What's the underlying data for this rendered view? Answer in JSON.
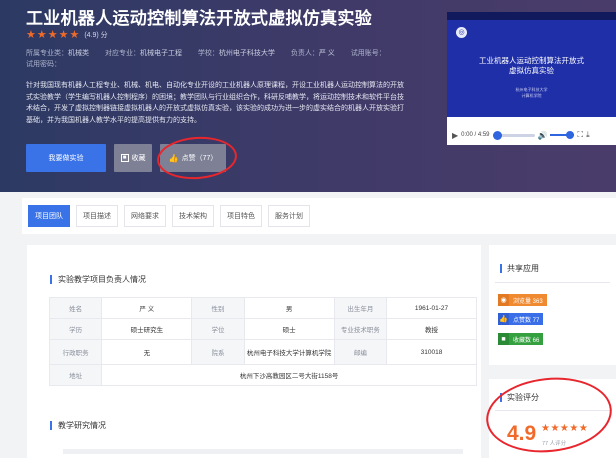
{
  "hero": {
    "title": "工业机器人运动控制算法开放式虚拟仿真实验",
    "stars": "★★★★★",
    "rating_text": "(4.9) 分",
    "meta": {
      "category_label": "所属专业类：",
      "category": "机械类",
      "major_label": "对应专业：",
      "major": "机械电子工程",
      "school_label": "学校：",
      "school": "杭州电子科技大学",
      "owner_label": "负责人：",
      "owner": "严 义",
      "account_label": "试用账号：",
      "account": "",
      "password_label": "试用密码：",
      "password": ""
    },
    "description": "针对我国现有机器人工程专业、机械、机电、自动化专业开设的工业机器人原理课程，开设工业机器人运动控制算法的开放式实验教学（学生编写机器人控制程序）的困境；教学团队与行业组织合作，科研反哺教学，将运动控制技术和软件平台技术结合，开发了虚拟控制器链接虚拟机器人的开放式虚拟仿真实验，该实验的成功为进一步的虚实结合的机器人开放实验打基础，并为我国机器人教学水平的提高提供有力的支持。",
    "buttons": {
      "start": "我要做实验",
      "favorite": "收藏",
      "like": "点赞（77）"
    }
  },
  "video": {
    "title_line1": "工业机器人运动控制算法开放式",
    "title_line2": "虚拟仿真实验",
    "sub_line1": "杭州电子科技大学",
    "sub_line2": "计算机学院",
    "time": "0:00 / 4:59",
    "progress": 0.0
  },
  "tabs": [
    {
      "label": "项目团队",
      "active": true
    },
    {
      "label": "项目描述",
      "active": false
    },
    {
      "label": "网络要求",
      "active": false
    },
    {
      "label": "技术架构",
      "active": false
    },
    {
      "label": "项目特色",
      "active": false
    },
    {
      "label": "服务计划",
      "active": false
    }
  ],
  "main": {
    "section1_title": "实验教学项目负责人情况",
    "section2_title": "教学研究情况",
    "table": {
      "r1": [
        "姓名",
        "严 义",
        "性别",
        "男",
        "出生年月",
        "1961-01-27"
      ],
      "r2": [
        "学历",
        "硕士研究生",
        "学位",
        "硕士",
        "专业技术职务",
        "教授"
      ],
      "r3": [
        "行政职务",
        "无",
        "院系",
        "杭州电子科技大学计算机学院",
        "邮编",
        "310018"
      ],
      "r4": [
        "地址",
        "杭州下沙高教园区二号大街1158号"
      ]
    }
  },
  "sidebar": {
    "share_title": "共享应用",
    "views": "浏览量 363",
    "likes": "点赞数 77",
    "favorites": "收藏数 66",
    "score_title": "实验评分",
    "score": "4.9",
    "score_stars": "★★★★★",
    "score_count": "77 人评分"
  },
  "colors": {
    "accent": "#3a73e8",
    "star": "#f06a2a",
    "annotation": "#e8262d"
  }
}
